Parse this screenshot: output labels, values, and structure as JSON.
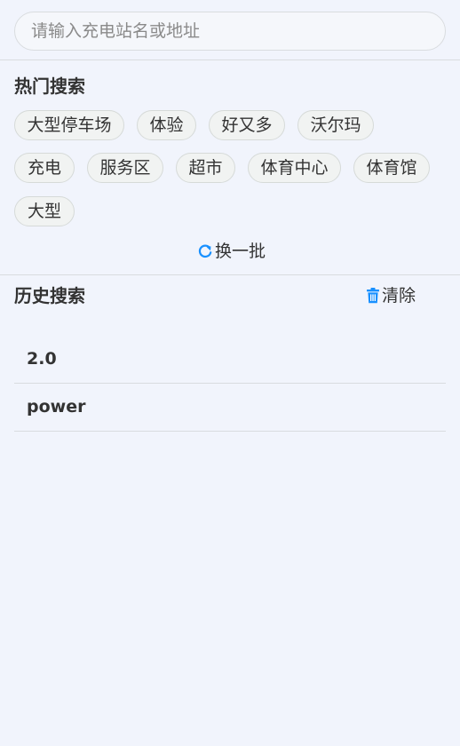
{
  "search": {
    "placeholder": "请输入充电站名或地址",
    "value": ""
  },
  "hot_search": {
    "title": "热门搜索",
    "tags": [
      "大型停车场",
      "体验",
      "好又多",
      "沃尔玛",
      "充电",
      "服务区",
      "超市",
      "体育中心",
      "体育馆",
      "大型"
    ],
    "refresh_label": "换一批",
    "refresh_icon": "refresh-icon"
  },
  "history": {
    "title": "历史搜索",
    "clear_label": "清除",
    "clear_icon": "trash-icon",
    "items": [
      "2.0",
      "power"
    ]
  },
  "colors": {
    "background": "#f1f4fc",
    "accent": "#1890ff",
    "text": "#333333",
    "chip_bg": "#f1f3f2",
    "border": "#d9dcdf"
  }
}
